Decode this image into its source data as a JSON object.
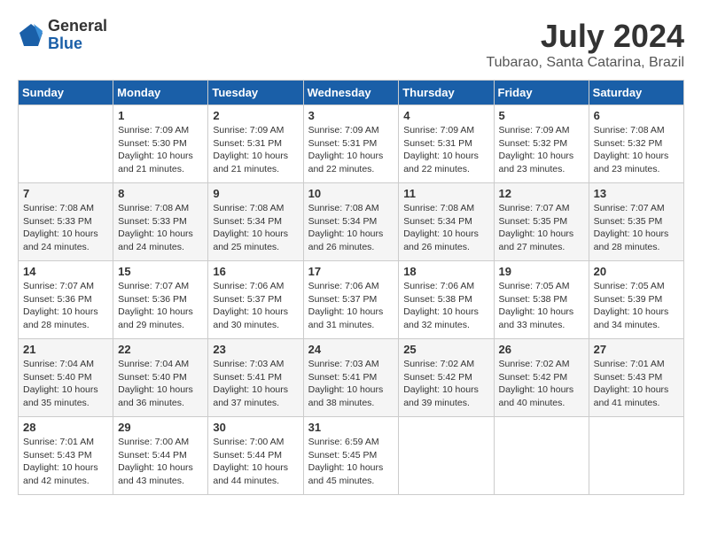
{
  "header": {
    "logo": {
      "general": "General",
      "blue": "Blue"
    },
    "month_year": "July 2024",
    "location": "Tubarao, Santa Catarina, Brazil"
  },
  "days_of_week": [
    "Sunday",
    "Monday",
    "Tuesday",
    "Wednesday",
    "Thursday",
    "Friday",
    "Saturday"
  ],
  "weeks": [
    [
      {
        "num": "",
        "info": ""
      },
      {
        "num": "1",
        "info": "Sunrise: 7:09 AM\nSunset: 5:30 PM\nDaylight: 10 hours\nand 21 minutes."
      },
      {
        "num": "2",
        "info": "Sunrise: 7:09 AM\nSunset: 5:31 PM\nDaylight: 10 hours\nand 21 minutes."
      },
      {
        "num": "3",
        "info": "Sunrise: 7:09 AM\nSunset: 5:31 PM\nDaylight: 10 hours\nand 22 minutes."
      },
      {
        "num": "4",
        "info": "Sunrise: 7:09 AM\nSunset: 5:31 PM\nDaylight: 10 hours\nand 22 minutes."
      },
      {
        "num": "5",
        "info": "Sunrise: 7:09 AM\nSunset: 5:32 PM\nDaylight: 10 hours\nand 23 minutes."
      },
      {
        "num": "6",
        "info": "Sunrise: 7:08 AM\nSunset: 5:32 PM\nDaylight: 10 hours\nand 23 minutes."
      }
    ],
    [
      {
        "num": "7",
        "info": "Sunrise: 7:08 AM\nSunset: 5:33 PM\nDaylight: 10 hours\nand 24 minutes."
      },
      {
        "num": "8",
        "info": "Sunrise: 7:08 AM\nSunset: 5:33 PM\nDaylight: 10 hours\nand 24 minutes."
      },
      {
        "num": "9",
        "info": "Sunrise: 7:08 AM\nSunset: 5:34 PM\nDaylight: 10 hours\nand 25 minutes."
      },
      {
        "num": "10",
        "info": "Sunrise: 7:08 AM\nSunset: 5:34 PM\nDaylight: 10 hours\nand 26 minutes."
      },
      {
        "num": "11",
        "info": "Sunrise: 7:08 AM\nSunset: 5:34 PM\nDaylight: 10 hours\nand 26 minutes."
      },
      {
        "num": "12",
        "info": "Sunrise: 7:07 AM\nSunset: 5:35 PM\nDaylight: 10 hours\nand 27 minutes."
      },
      {
        "num": "13",
        "info": "Sunrise: 7:07 AM\nSunset: 5:35 PM\nDaylight: 10 hours\nand 28 minutes."
      }
    ],
    [
      {
        "num": "14",
        "info": "Sunrise: 7:07 AM\nSunset: 5:36 PM\nDaylight: 10 hours\nand 28 minutes."
      },
      {
        "num": "15",
        "info": "Sunrise: 7:07 AM\nSunset: 5:36 PM\nDaylight: 10 hours\nand 29 minutes."
      },
      {
        "num": "16",
        "info": "Sunrise: 7:06 AM\nSunset: 5:37 PM\nDaylight: 10 hours\nand 30 minutes."
      },
      {
        "num": "17",
        "info": "Sunrise: 7:06 AM\nSunset: 5:37 PM\nDaylight: 10 hours\nand 31 minutes."
      },
      {
        "num": "18",
        "info": "Sunrise: 7:06 AM\nSunset: 5:38 PM\nDaylight: 10 hours\nand 32 minutes."
      },
      {
        "num": "19",
        "info": "Sunrise: 7:05 AM\nSunset: 5:38 PM\nDaylight: 10 hours\nand 33 minutes."
      },
      {
        "num": "20",
        "info": "Sunrise: 7:05 AM\nSunset: 5:39 PM\nDaylight: 10 hours\nand 34 minutes."
      }
    ],
    [
      {
        "num": "21",
        "info": "Sunrise: 7:04 AM\nSunset: 5:40 PM\nDaylight: 10 hours\nand 35 minutes."
      },
      {
        "num": "22",
        "info": "Sunrise: 7:04 AM\nSunset: 5:40 PM\nDaylight: 10 hours\nand 36 minutes."
      },
      {
        "num": "23",
        "info": "Sunrise: 7:03 AM\nSunset: 5:41 PM\nDaylight: 10 hours\nand 37 minutes."
      },
      {
        "num": "24",
        "info": "Sunrise: 7:03 AM\nSunset: 5:41 PM\nDaylight: 10 hours\nand 38 minutes."
      },
      {
        "num": "25",
        "info": "Sunrise: 7:02 AM\nSunset: 5:42 PM\nDaylight: 10 hours\nand 39 minutes."
      },
      {
        "num": "26",
        "info": "Sunrise: 7:02 AM\nSunset: 5:42 PM\nDaylight: 10 hours\nand 40 minutes."
      },
      {
        "num": "27",
        "info": "Sunrise: 7:01 AM\nSunset: 5:43 PM\nDaylight: 10 hours\nand 41 minutes."
      }
    ],
    [
      {
        "num": "28",
        "info": "Sunrise: 7:01 AM\nSunset: 5:43 PM\nDaylight: 10 hours\nand 42 minutes."
      },
      {
        "num": "29",
        "info": "Sunrise: 7:00 AM\nSunset: 5:44 PM\nDaylight: 10 hours\nand 43 minutes."
      },
      {
        "num": "30",
        "info": "Sunrise: 7:00 AM\nSunset: 5:44 PM\nDaylight: 10 hours\nand 44 minutes."
      },
      {
        "num": "31",
        "info": "Sunrise: 6:59 AM\nSunset: 5:45 PM\nDaylight: 10 hours\nand 45 minutes."
      },
      {
        "num": "",
        "info": ""
      },
      {
        "num": "",
        "info": ""
      },
      {
        "num": "",
        "info": ""
      }
    ]
  ]
}
